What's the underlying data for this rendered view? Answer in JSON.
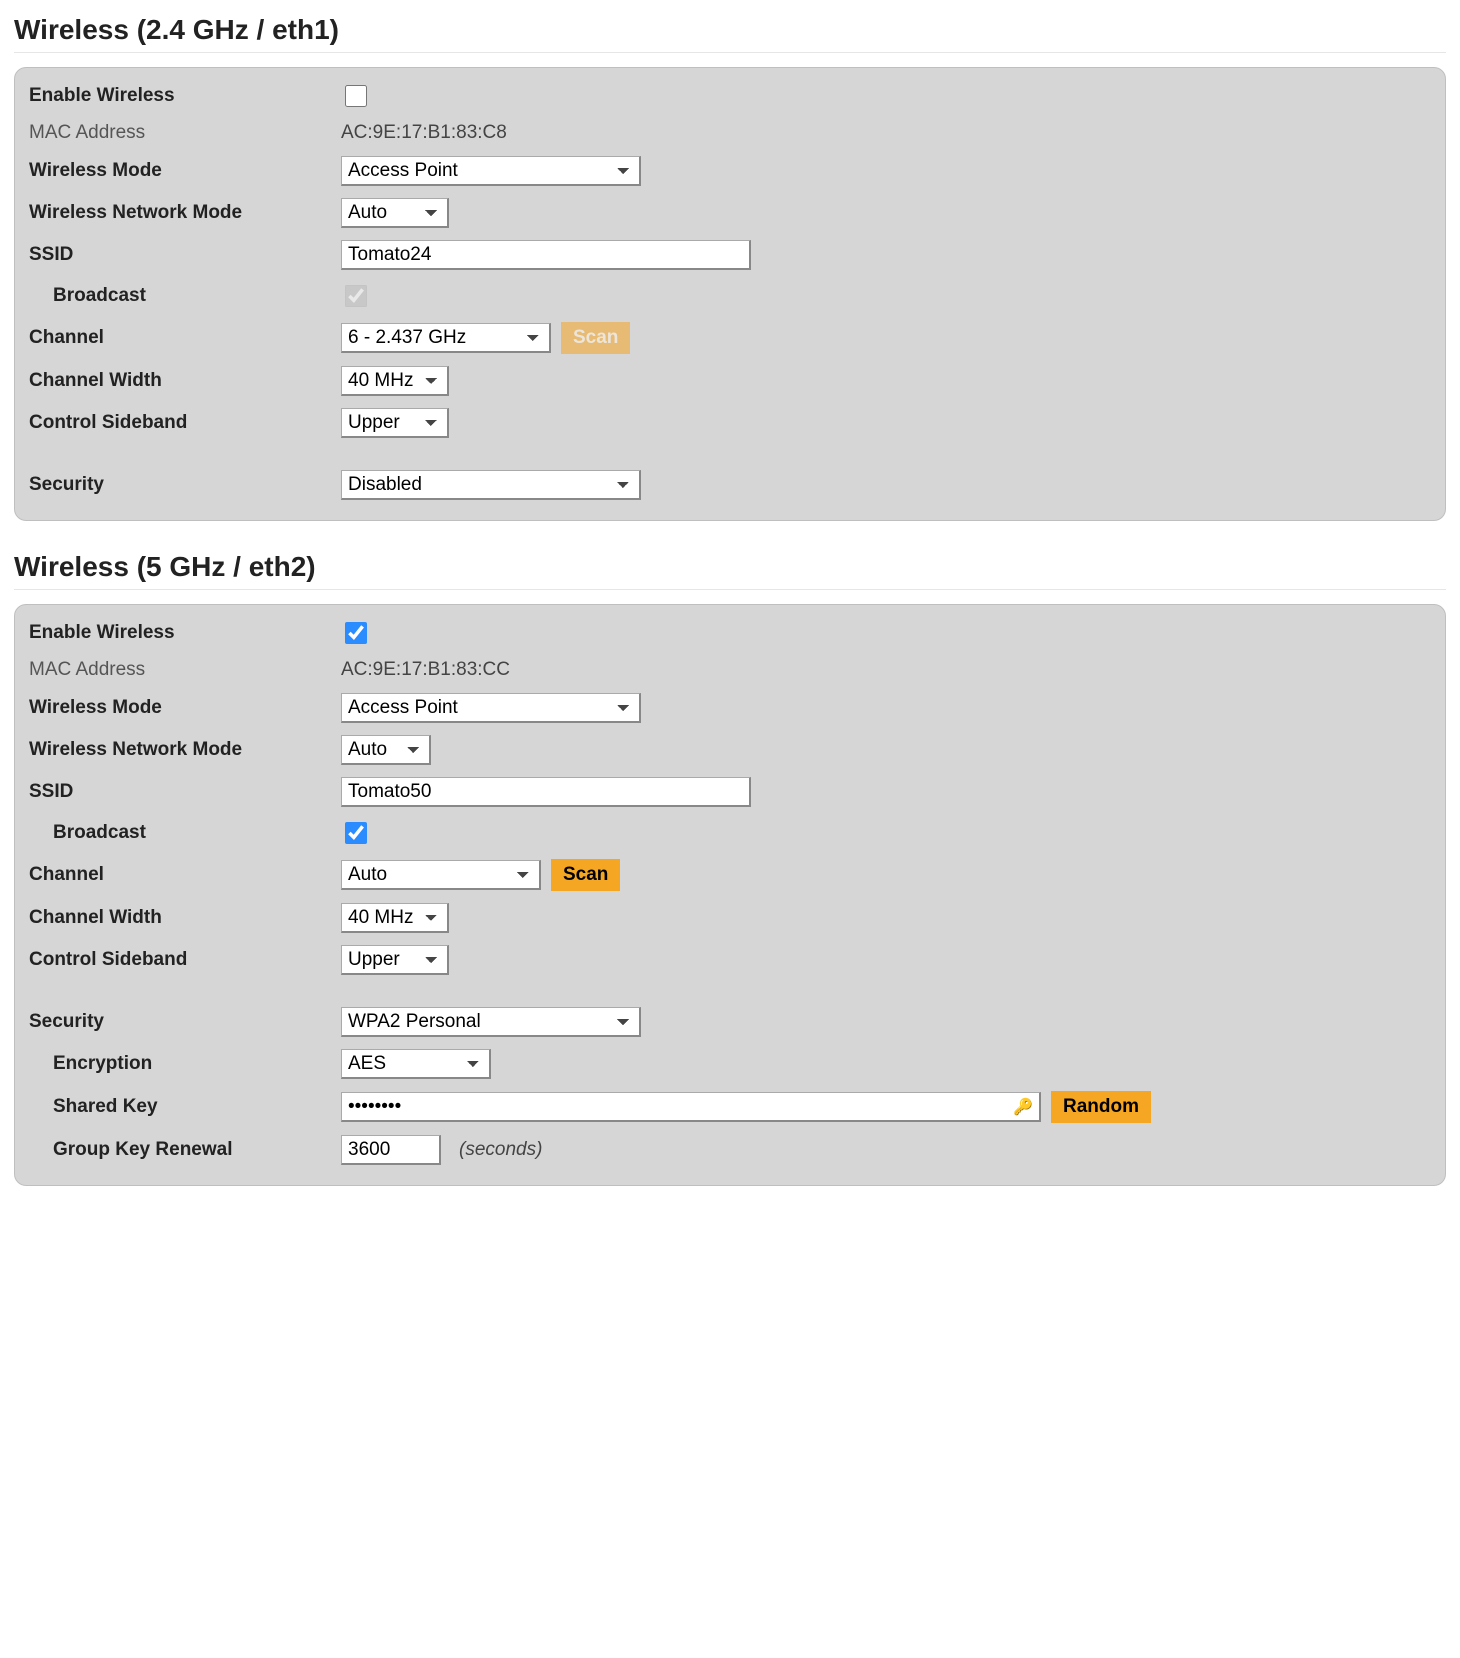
{
  "labels": {
    "enable_wireless": "Enable Wireless",
    "mac_address": "MAC Address",
    "wireless_mode": "Wireless Mode",
    "wireless_network_mode": "Wireless Network Mode",
    "ssid": "SSID",
    "broadcast": "Broadcast",
    "channel": "Channel",
    "channel_width": "Channel Width",
    "control_sideband": "Control Sideband",
    "security": "Security",
    "encryption": "Encryption",
    "shared_key": "Shared Key",
    "group_key_renewal": "Group Key Renewal",
    "seconds": "(seconds)",
    "scan": "Scan",
    "random": "Random"
  },
  "sections": {
    "w24": {
      "title": "Wireless (2.4 GHz / eth1)",
      "enable": false,
      "mac": "AC:9E:17:B1:83:C8",
      "wireless_mode": "Access Point",
      "network_mode": "Auto",
      "ssid": "Tomato24",
      "broadcast": true,
      "broadcast_disabled": true,
      "channel": "6 - 2.437 GHz",
      "channel_width": "40 MHz",
      "control_sideband": "Upper",
      "security": "Disabled",
      "scan_disabled": true
    },
    "w5": {
      "title": "Wireless (5 GHz / eth2)",
      "enable": true,
      "mac": "AC:9E:17:B1:83:CC",
      "wireless_mode": "Access Point",
      "network_mode": "Auto",
      "ssid": "Tomato50",
      "broadcast": true,
      "broadcast_disabled": false,
      "channel": "Auto",
      "channel_width": "40 MHz",
      "control_sideband": "Upper",
      "security": "WPA2 Personal",
      "scan_disabled": false,
      "encryption": "AES",
      "shared_key": "••••••••",
      "group_key_renewal": "3600"
    }
  }
}
